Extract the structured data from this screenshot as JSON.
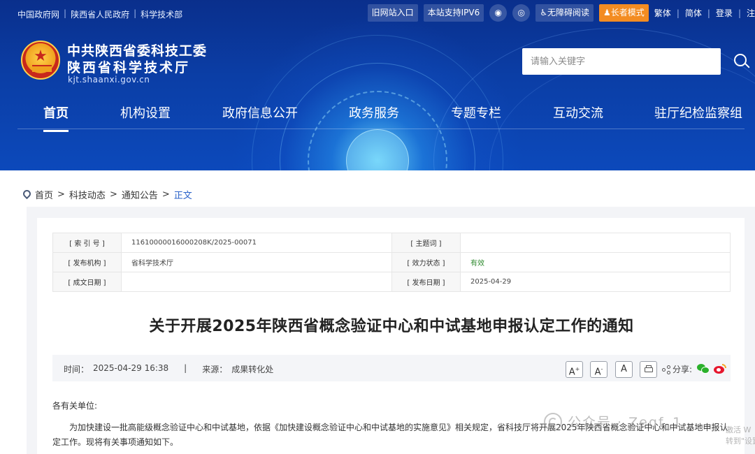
{
  "top_links": [
    "中国政府网",
    "陕西省人民政府",
    "科学技术部"
  ],
  "top_right": {
    "old_site": "旧网站入口",
    "ipv6": "本站支持IPV6",
    "wechat_icon": "wechat-icon",
    "weibo_icon": "weibo-icon",
    "accessibility": "无障碍阅读",
    "elder_mode": "长者模式",
    "traditional": "繁体",
    "simplified": "简体",
    "login": "登录",
    "register_partial": "注"
  },
  "logo": {
    "line1": "中共陕西省委科技工委",
    "line2": "陕西省科学技术厅",
    "domain": "kjt.shaanxi.gov.cn"
  },
  "search": {
    "placeholder": "请输入关键字"
  },
  "nav": [
    "首页",
    "机构设置",
    "政府信息公开",
    "政务服务",
    "专题专栏",
    "互动交流",
    "驻厅纪检监察组"
  ],
  "breadcrumb": [
    "首页",
    "科技动态",
    "通知公告",
    "正文"
  ],
  "meta": {
    "index_label": "[ 索 引 号 ]",
    "index_value": "11610000016000208K/2025-00071",
    "topic_label": "[ 主题词 ]",
    "topic_value": "",
    "publisher_label": "[ 发布机构 ]",
    "publisher_value": "省科学技术厅",
    "status_label": "[ 效力状态 ]",
    "status_value": "有效",
    "written_label": "[ 成文日期 ]",
    "written_value": "",
    "release_label": "[ 发布日期 ]",
    "release_value": "2025-04-29"
  },
  "article": {
    "title": "关于开展2025年陕西省概念验证中心和中试基地申报认定工作的通知",
    "time_label": "时间：",
    "time_value": "2025-04-29 16:38",
    "divider": "|",
    "source_label": "来源：",
    "source_value": "成果转化处",
    "font_large": "A",
    "font_mid": "A",
    "font_small": "A",
    "share_label": "分享:",
    "salutation": "各有关单位:",
    "paragraph": "为加快建设一批高能级概念验证中心和中试基地，依据《加快建设概念验证中心和中试基地的实施意见》相关规定，省科技厅将开展2025年陕西省概念验证中心和中试基地申报认定工作。现将有关事项通知如下。"
  },
  "watermark": {
    "text": "公众号 · Zeqf_1"
  },
  "corner": {
    "line1": "激活 W",
    "line2": "转到\"设置"
  }
}
